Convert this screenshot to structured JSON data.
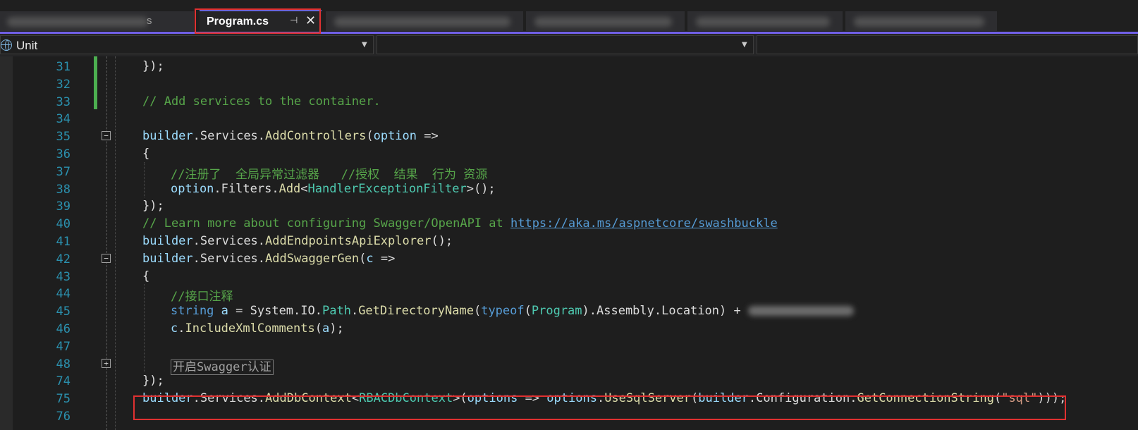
{
  "tabs": {
    "active": {
      "label": "Program.cs",
      "pin_glyph": "⊣",
      "close_glyph": "✕"
    },
    "partial_tail": "s"
  },
  "navbar": {
    "project": "Unit",
    "members": ""
  },
  "editor": {
    "lines": [
      {
        "n": "31",
        "tokens": [
          {
            "t": "pl",
            "v": "});"
          }
        ]
      },
      {
        "n": "32",
        "tokens": []
      },
      {
        "n": "33",
        "tokens": [
          {
            "t": "cm",
            "v": "// Add services to the container."
          }
        ]
      },
      {
        "n": "34",
        "tokens": []
      },
      {
        "n": "35",
        "fold": "−",
        "tokens": [
          {
            "t": "id",
            "v": "builder"
          },
          {
            "t": "pl",
            "v": "."
          },
          {
            "t": "pl",
            "v": "Services"
          },
          {
            "t": "pl",
            "v": "."
          },
          {
            "t": "fn",
            "v": "AddControllers"
          },
          {
            "t": "pl",
            "v": "("
          },
          {
            "t": "id",
            "v": "option"
          },
          {
            "t": "pl",
            "v": " =>"
          }
        ]
      },
      {
        "n": "36",
        "tokens": [
          {
            "t": "pl",
            "v": "{"
          }
        ]
      },
      {
        "n": "37",
        "indent": true,
        "tokens": [
          {
            "t": "cm",
            "v": "//注册了  全局异常过滤器   //授权  结果  行为 资源"
          }
        ]
      },
      {
        "n": "38",
        "indent": true,
        "tokens": [
          {
            "t": "id",
            "v": "option"
          },
          {
            "t": "pl",
            "v": "."
          },
          {
            "t": "pl",
            "v": "Filters"
          },
          {
            "t": "pl",
            "v": "."
          },
          {
            "t": "fn",
            "v": "Add"
          },
          {
            "t": "pl",
            "v": "<"
          },
          {
            "t": "ty",
            "v": "HandlerExceptionFilter"
          },
          {
            "t": "pl",
            "v": ">();"
          }
        ]
      },
      {
        "n": "39",
        "tokens": [
          {
            "t": "pl",
            "v": "});"
          }
        ]
      },
      {
        "n": "40",
        "tokens": [
          {
            "t": "cm",
            "v": "// Learn more about configuring Swagger/OpenAPI at "
          },
          {
            "t": "lk",
            "v": "https://aka.ms/aspnetcore/swashbuckle"
          }
        ]
      },
      {
        "n": "41",
        "tokens": [
          {
            "t": "id",
            "v": "builder"
          },
          {
            "t": "pl",
            "v": "."
          },
          {
            "t": "pl",
            "v": "Services"
          },
          {
            "t": "pl",
            "v": "."
          },
          {
            "t": "fn",
            "v": "AddEndpointsApiExplorer"
          },
          {
            "t": "pl",
            "v": "();"
          }
        ]
      },
      {
        "n": "42",
        "fold": "−",
        "tokens": [
          {
            "t": "id",
            "v": "builder"
          },
          {
            "t": "pl",
            "v": "."
          },
          {
            "t": "pl",
            "v": "Services"
          },
          {
            "t": "pl",
            "v": "."
          },
          {
            "t": "fn",
            "v": "AddSwaggerGen"
          },
          {
            "t": "pl",
            "v": "("
          },
          {
            "t": "id",
            "v": "c"
          },
          {
            "t": "pl",
            "v": " =>"
          }
        ]
      },
      {
        "n": "43",
        "tokens": [
          {
            "t": "pl",
            "v": "{"
          }
        ]
      },
      {
        "n": "44",
        "indent": true,
        "tokens": [
          {
            "t": "cm",
            "v": "//接口注释"
          }
        ]
      },
      {
        "n": "45",
        "indent": true,
        "tokens": [
          {
            "t": "kw",
            "v": "string"
          },
          {
            "t": "pl",
            "v": " "
          },
          {
            "t": "id",
            "v": "a"
          },
          {
            "t": "pl",
            "v": " = System.IO."
          },
          {
            "t": "ty",
            "v": "Path"
          },
          {
            "t": "pl",
            "v": "."
          },
          {
            "t": "fn",
            "v": "GetDirectoryName"
          },
          {
            "t": "pl",
            "v": "("
          },
          {
            "t": "kw",
            "v": "typeof"
          },
          {
            "t": "pl",
            "v": "("
          },
          {
            "t": "ty",
            "v": "Program"
          },
          {
            "t": "pl",
            "v": ").Assembly.Location) + "
          },
          {
            "t": "blur",
            "v": ""
          }
        ]
      },
      {
        "n": "46",
        "indent": true,
        "tokens": [
          {
            "t": "id",
            "v": "c"
          },
          {
            "t": "pl",
            "v": "."
          },
          {
            "t": "fn",
            "v": "IncludeXmlComments"
          },
          {
            "t": "pl",
            "v": "("
          },
          {
            "t": "id",
            "v": "a"
          },
          {
            "t": "pl",
            "v": ");"
          }
        ]
      },
      {
        "n": "47",
        "tokens": []
      },
      {
        "n": "48",
        "fold": "+",
        "indent": true,
        "tokens": [
          {
            "t": "collapsed",
            "v": "开启Swagger认证"
          }
        ]
      },
      {
        "n": "74",
        "tokens": [
          {
            "t": "pl",
            "v": "});"
          }
        ]
      },
      {
        "n": "75",
        "tokens": [
          {
            "t": "id",
            "v": "builder"
          },
          {
            "t": "pl",
            "v": "."
          },
          {
            "t": "pl",
            "v": "Services"
          },
          {
            "t": "pl",
            "v": "."
          },
          {
            "t": "fn",
            "v": "AddDbContext"
          },
          {
            "t": "pl",
            "v": "<"
          },
          {
            "t": "ty",
            "v": "RBACDbContext"
          },
          {
            "t": "pl",
            "v": ">("
          },
          {
            "t": "id",
            "v": "options"
          },
          {
            "t": "pl",
            "v": " => "
          },
          {
            "t": "id",
            "v": "options"
          },
          {
            "t": "pl",
            "v": "."
          },
          {
            "t": "fn",
            "v": "UseSqlServer"
          },
          {
            "t": "pl",
            "v": "("
          },
          {
            "t": "id",
            "v": "builder"
          },
          {
            "t": "pl",
            "v": "."
          },
          {
            "t": "pl",
            "v": "Configuration"
          },
          {
            "t": "pl",
            "v": "."
          },
          {
            "t": "fn",
            "v": "GetConnectionString"
          },
          {
            "t": "pl",
            "v": "("
          },
          {
            "t": "st",
            "v": "\"sql\""
          },
          {
            "t": "pl",
            "v": ")));"
          }
        ]
      },
      {
        "n": "76",
        "tokens": []
      }
    ]
  },
  "colors": {
    "accent": "#7160e8",
    "annotation": "#e03131",
    "comment": "#57a64a",
    "line_number": "#2b91af"
  }
}
